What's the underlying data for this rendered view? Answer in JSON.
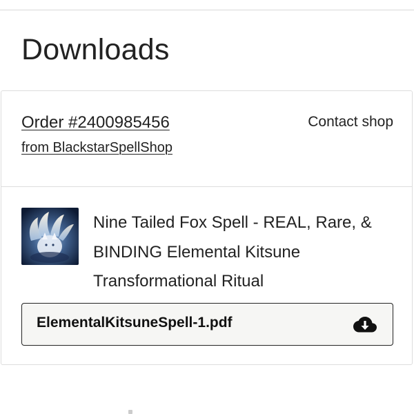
{
  "page": {
    "title": "Downloads"
  },
  "order": {
    "number_label": "Order #2400985456",
    "shop_label": "from BlackstarSpellShop",
    "contact_label": "Contact shop"
  },
  "item": {
    "title": "Nine Tailed Fox Spell - REAL, Rare, & BINDING Elemental Kitsune Transformational Ritual",
    "thumbnail_icon": "kitsune-fox-thumbnail",
    "download": {
      "file_name": "ElementalKitsuneSpell-1.pdf",
      "icon": "cloud-download-icon"
    }
  },
  "colors": {
    "text": "#222222",
    "border": "#dddddd",
    "button_bg": "#f6f6f4",
    "button_border": "#222222"
  }
}
